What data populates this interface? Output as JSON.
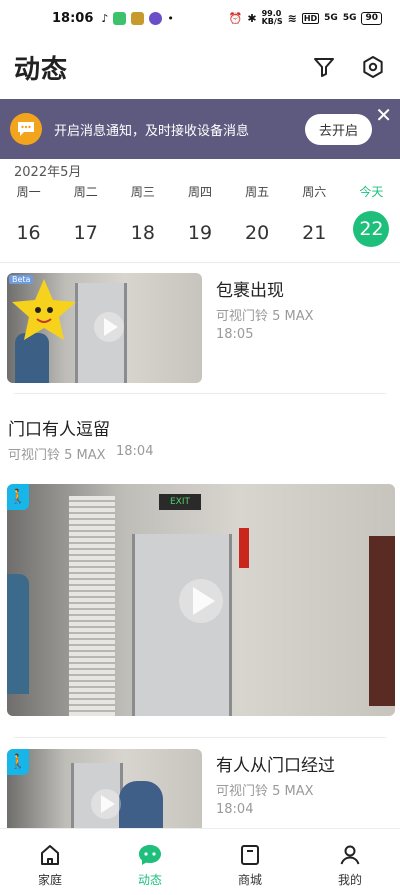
{
  "status_bar": {
    "time": "18:06",
    "net_speed": "99.0\nKB/S",
    "battery": "90",
    "signal1": "5G",
    "signal2": "5G"
  },
  "header": {
    "title": "动态",
    "filter_icon": "filter-icon",
    "settings_icon": "settings-icon"
  },
  "banner": {
    "text": "开启消息通知，及时接收设备消息",
    "button": "去开启",
    "close": "✕"
  },
  "calendar": {
    "month": "2022年5月",
    "days": [
      {
        "weekday": "周一",
        "date": "16"
      },
      {
        "weekday": "周二",
        "date": "17"
      },
      {
        "weekday": "周三",
        "date": "18"
      },
      {
        "weekday": "周四",
        "date": "19"
      },
      {
        "weekday": "周五",
        "date": "20"
      },
      {
        "weekday": "周六",
        "date": "21"
      },
      {
        "weekday": "今天",
        "date": "22"
      }
    ],
    "selected_index": 6
  },
  "events": [
    {
      "title": "包裹出现",
      "device": "可视门铃 5 MAX",
      "time": "18:05",
      "thumb_badge": "Beta"
    },
    {
      "title": "门口有人逗留",
      "device": "可视门铃 5 MAX",
      "time": "18:04",
      "exit_sign": "EXIT"
    },
    {
      "title": "有人从门口经过",
      "device": "可视门铃 5 MAX",
      "time": "18:04"
    }
  ],
  "bottom_nav": [
    {
      "label": "家庭",
      "icon": "home-icon"
    },
    {
      "label": "动态",
      "icon": "chat-bubble-icon"
    },
    {
      "label": "商城",
      "icon": "store-icon"
    },
    {
      "label": "我的",
      "icon": "profile-icon"
    }
  ],
  "active_nav": 1,
  "colors": {
    "accent": "#1dbf7b",
    "banner_bg": "#5e5a7f",
    "bell": "#f2a51c",
    "motion_badge": "#18b6e8"
  }
}
